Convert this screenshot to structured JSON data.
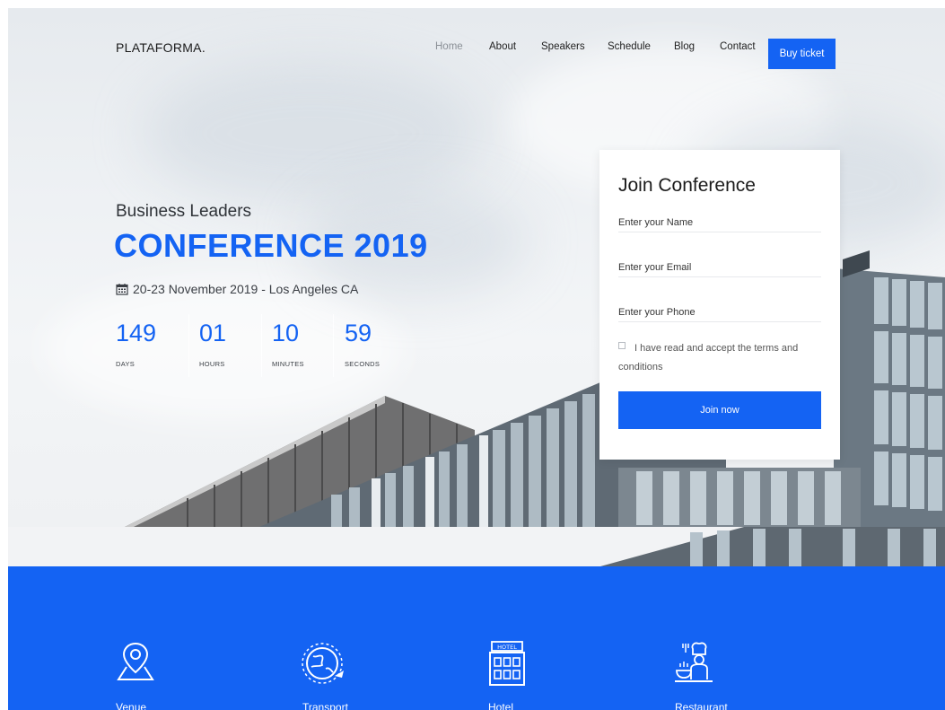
{
  "nav": {
    "logo": "PLATAFORMA.",
    "links": [
      "Home",
      "About",
      "Speakers",
      "Schedule",
      "Blog",
      "Contact"
    ],
    "active": "Home",
    "cta": "Buy ticket"
  },
  "hero": {
    "subtitle": "Business Leaders",
    "title": "CONFERENCE 2019",
    "date": "20-23 November 2019 - Los Angeles CA",
    "date_icon": "calendar-icon",
    "countdown": [
      {
        "value": "149",
        "label": "DAYS"
      },
      {
        "value": "01",
        "label": "HOURS"
      },
      {
        "value": "10",
        "label": "MINUTES"
      },
      {
        "value": "59",
        "label": "SECONDS"
      }
    ]
  },
  "form": {
    "title": "Join Conference",
    "name_placeholder": "Enter your Name",
    "email_placeholder": "Enter your Email",
    "phone_placeholder": "Enter your Phone",
    "terms": "I have read and accept the terms and conditions",
    "submit": "Join now"
  },
  "services": [
    {
      "label": "Venue",
      "icon": "map-pin-icon"
    },
    {
      "label": "Transport",
      "icon": "globe-plane-icon"
    },
    {
      "label": "Hotel",
      "icon": "hotel-icon"
    },
    {
      "label": "Restaurant",
      "icon": "chef-icon"
    }
  ],
  "colors": {
    "accent": "#1463f3"
  }
}
